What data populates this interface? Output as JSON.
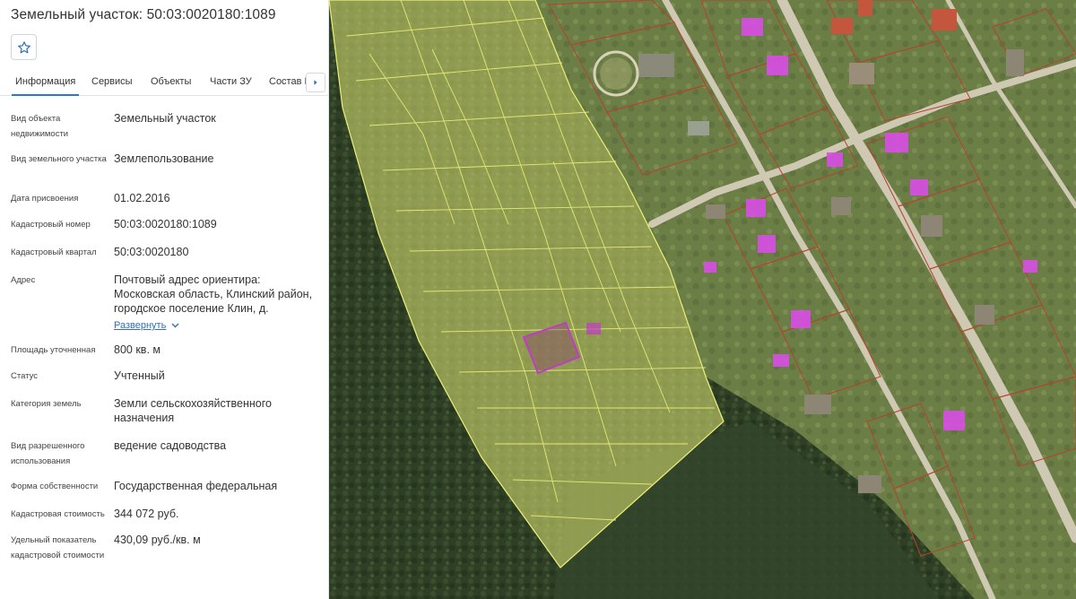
{
  "header": {
    "title": "Земельный участок: 50:03:0020180:1089",
    "favorite_icon": "star-outline-icon"
  },
  "tabs": [
    {
      "label": "Информация",
      "active": true
    },
    {
      "label": "Сервисы",
      "active": false
    },
    {
      "label": "Объекты",
      "active": false
    },
    {
      "label": "Части ЗУ",
      "active": false
    },
    {
      "label": "Состав ЕЗП",
      "active": false
    }
  ],
  "tabs_scroll_icon": "chevron-right-icon",
  "info": [
    {
      "label": "Вид объекта недвижимости",
      "value": "Земельный участок"
    },
    {
      "label": "Вид земельного участка",
      "value": "Землепользование"
    },
    {
      "label": "Дата присвоения",
      "value": "01.02.2016"
    },
    {
      "label": "Кадастровый номер",
      "value": "50:03:0020180:1089"
    },
    {
      "label": "Кадастровый квартал",
      "value": "50:03:0020180"
    },
    {
      "label": "Адрес",
      "value": "Почтовый адрес ориентира: Московская область, Клинский район, городское поселение Клин, д."
    },
    {
      "label": "Площадь уточненная",
      "value": "800 кв. м"
    },
    {
      "label": "Статус",
      "value": "Учтенный"
    },
    {
      "label": "Категория земель",
      "value": "Земли сельскохозяйственного назначения"
    },
    {
      "label": "Вид разрешенного использования",
      "value": "ведение садоводства"
    },
    {
      "label": "Форма собственности",
      "value": "Государственная федеральная"
    },
    {
      "label": "Кадастровая стоимость",
      "value": "344 072 руб."
    },
    {
      "label": "Удельный показатель кадастровой стоимости",
      "value": "430,09 руб./кв. м"
    }
  ],
  "address_expand": {
    "label": "Развернуть",
    "icon": "chevron-down-icon"
  },
  "map": {
    "layer": "satellite",
    "colors": {
      "forest": "#2e3f25",
      "parcel_fill": "#c9d36a",
      "parcel_line": "#eef07a",
      "selected_parcel": "#c23bc8",
      "building_highlight": "#d84ee6",
      "plot_border": "#b6422f",
      "road": "#c9c2ae"
    }
  }
}
